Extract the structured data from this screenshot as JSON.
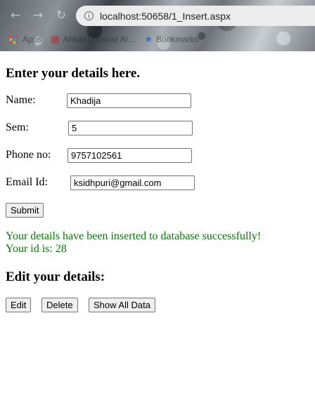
{
  "browser": {
    "url": "localhost:50658/1_Insert.aspx",
    "bookmarks": [
      {
        "label": "Apps"
      },
      {
        "label": "Ahkam - Usool Al..."
      },
      {
        "label": "Bookmarks"
      }
    ]
  },
  "form": {
    "heading": "Enter your details here.",
    "name_label": "Name:",
    "name_value": "Khadija",
    "sem_label": "Sem:",
    "sem_value": "5",
    "phone_label": "Phone no:",
    "phone_value": "9757102561",
    "email_label": "Email Id:",
    "email_value": "ksidhpuri@gmail.com",
    "submit_label": "Submit"
  },
  "status": {
    "message": "Your details have been inserted to database successfully!",
    "id_line": "Your id is: 28",
    "color": "#007a00"
  },
  "edit": {
    "heading": "Edit your details:",
    "edit_label": "Edit",
    "delete_label": "Delete",
    "show_all_label": "Show All Data"
  }
}
